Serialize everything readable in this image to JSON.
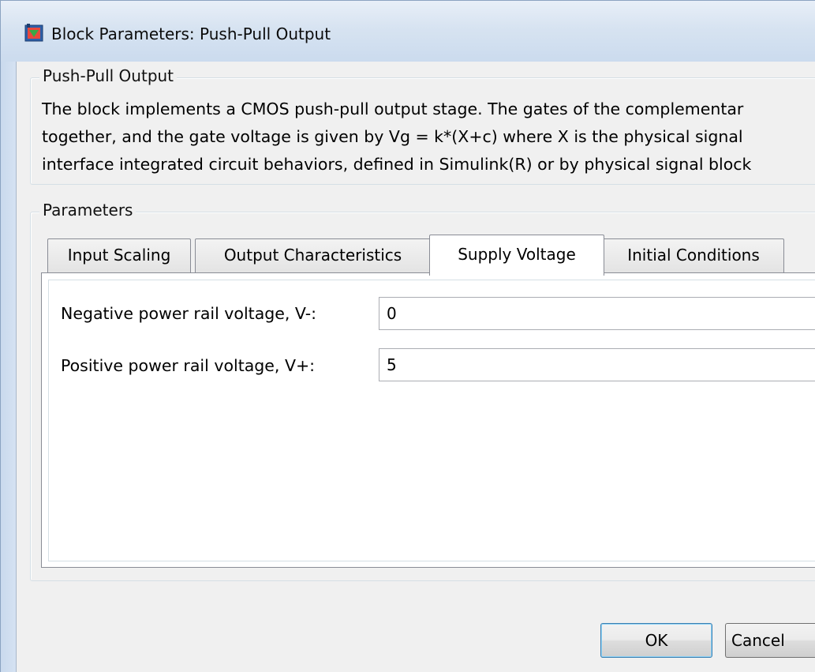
{
  "window": {
    "title": "Block Parameters: Push-Pull Output",
    "icon": "simulink-block-icon"
  },
  "description_group": {
    "legend": "Push-Pull Output",
    "lines": [
      "The block implements a CMOS push-pull output stage. The gates of the complementar",
      "together, and the gate voltage is given by Vg = k*(X+c) where X is the physical signal",
      "interface integrated circuit behaviors, defined in Simulink(R) or by physical signal block"
    ]
  },
  "parameters_group": {
    "legend": "Parameters",
    "tabs": [
      {
        "label": "Input Scaling",
        "active": false
      },
      {
        "label": "Output Characteristics",
        "active": false
      },
      {
        "label": "Supply Voltage",
        "active": true
      },
      {
        "label": "Initial Conditions",
        "active": false
      }
    ],
    "fields": [
      {
        "label": "Negative power rail voltage, V-:",
        "value": "0"
      },
      {
        "label": "Positive power rail voltage, V+:",
        "value": "5"
      }
    ]
  },
  "buttons": {
    "ok": "OK",
    "cancel": "Cancel"
  },
  "colors": {
    "dialog_background": "#f0f0f0",
    "titlebar": "#d7e3f1",
    "default_button_border": "#3c7fb1"
  }
}
